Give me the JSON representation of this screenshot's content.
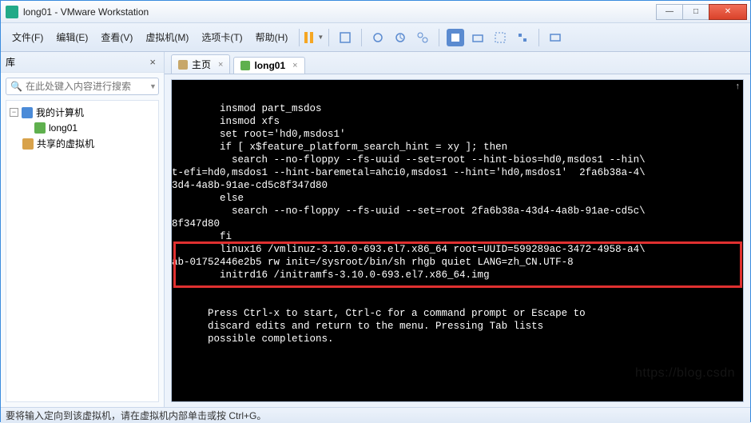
{
  "window": {
    "title": "long01 - VMware Workstation",
    "min": "—",
    "max": "□",
    "close": "✕"
  },
  "menu": {
    "file": "文件(F)",
    "edit": "编辑(E)",
    "view": "查看(V)",
    "vm": "虚拟机(M)",
    "tabs": "选项卡(T)",
    "help": "帮助(H)"
  },
  "sidebar": {
    "header": "库",
    "close": "×",
    "search_placeholder": "在此处键入内容进行搜索",
    "tree": {
      "root": "我的计算机",
      "vm": "long01",
      "shared": "共享的虚拟机"
    }
  },
  "tabs": {
    "home": "主页",
    "vm": "long01",
    "close": "×"
  },
  "console": {
    "lines": "        insmod part_msdos\n        insmod xfs\n        set root='hd0,msdos1'\n        if [ x$feature_platform_search_hint = xy ]; then\n          search --no-floppy --fs-uuid --set=root --hint-bios=hd0,msdos1 --hin\\\nt-efi=hd0,msdos1 --hint-baremetal=ahci0,msdos1 --hint='hd0,msdos1'  2fa6b38a-4\\\n3d4-4a8b-91ae-cd5c8f347d80\n        else\n          search --no-floppy --fs-uuid --set=root 2fa6b38a-43d4-4a8b-91ae-cd5c\\\n8f347d80\n        fi\n        linux16 /vmlinuz-3.10.0-693.el7.x86_64 root=UUID=599289ac-3472-4958-a4\\\nab-01752446e2b5 rw init=/sysroot/bin/sh rhgb quiet LANG=zh_CN.UTF-8\n        initrd16 /initramfs-3.10.0-693.el7.x86_64.img\n\n\n      Press Ctrl-x to start, Ctrl-c for a command prompt or Escape to\n      discard edits and return to the menu. Pressing Tab lists\n      possible completions."
  },
  "status": "要将输入定向到该虚拟机，请在虚拟机内部单击或按 Ctrl+G。",
  "watermark": "https://blog.csdn"
}
